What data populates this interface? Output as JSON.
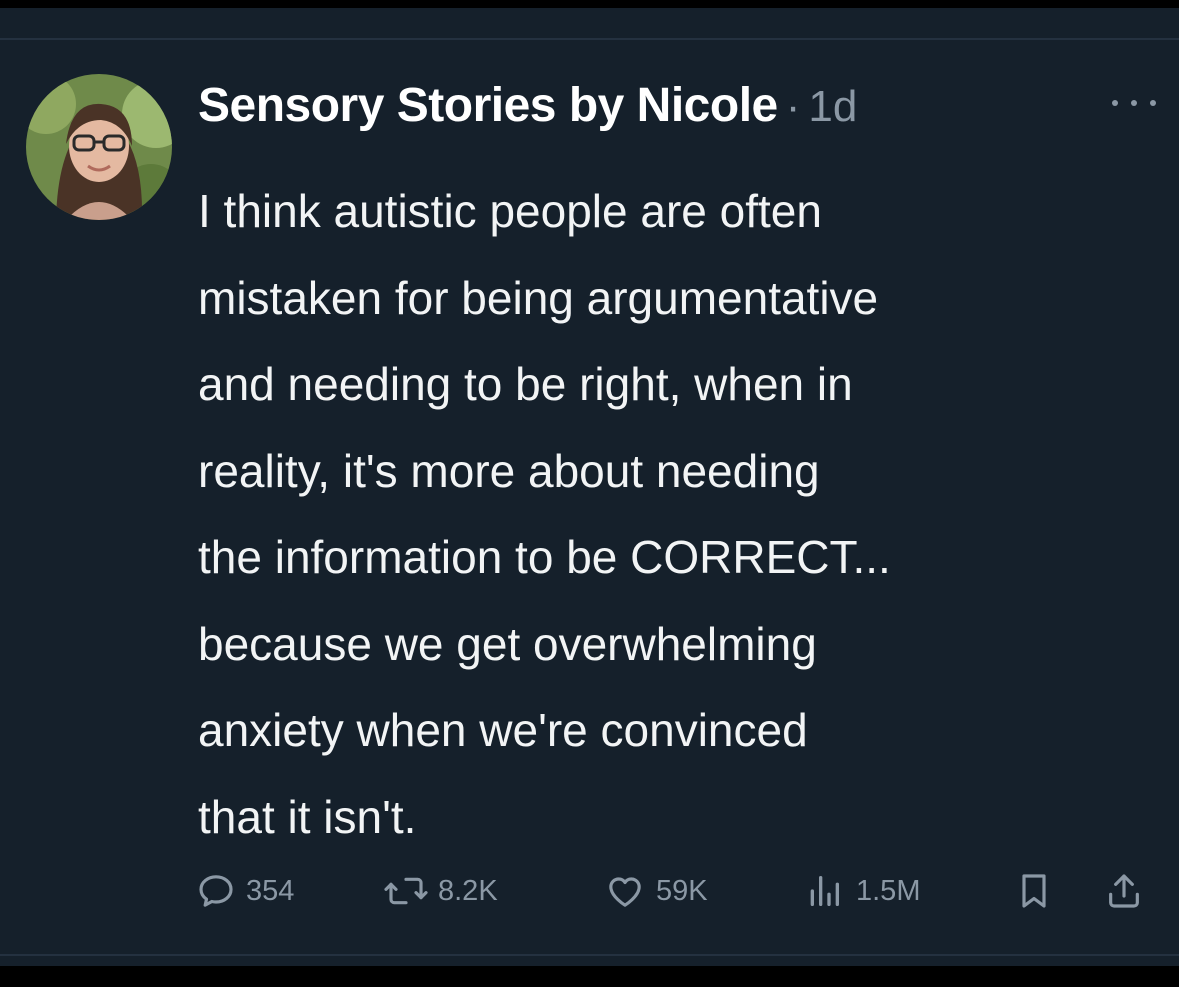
{
  "tweet": {
    "author_name": "Sensory Stories by Nicole",
    "separator": "·",
    "timestamp": "1d",
    "text_lines": [
      "I think autistic people are often",
      "mistaken for being argumentative",
      "and needing to be right, when in",
      "reality, it's more about needing",
      "the information to be CORRECT...",
      "because we get overwhelming",
      "anxiety when we're convinced",
      "that it isn't."
    ]
  },
  "actions": {
    "replies": "354",
    "reposts": "8.2K",
    "likes": "59K",
    "views": "1.5M"
  },
  "icons": {
    "more": "more-horizontal-icon",
    "reply": "reply-bubble-icon",
    "repost": "repost-icon",
    "like": "heart-icon",
    "views": "bar-chart-icon",
    "bookmark": "bookmark-icon",
    "share": "share-upload-icon"
  },
  "colors": {
    "background": "#15202b",
    "text": "#e7e9ea",
    "muted": "#8b98a5"
  }
}
